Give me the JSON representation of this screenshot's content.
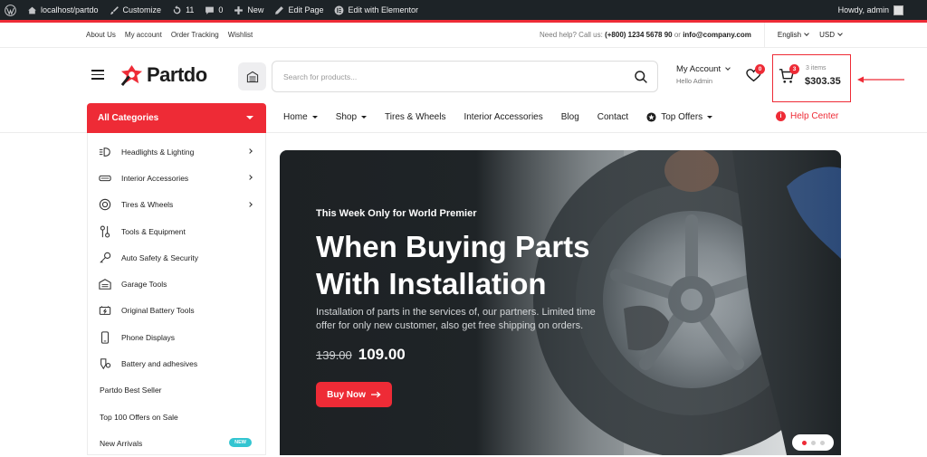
{
  "adminbar": {
    "site": "localhost/partdo",
    "customize": "Customize",
    "updates": "11",
    "comments": "0",
    "new": "New",
    "edit_page": "Edit Page",
    "elementor": "Edit with Elementor",
    "howdy": "Howdy, admin"
  },
  "topbar": {
    "links": [
      "About Us",
      "My account",
      "Order Tracking",
      "Wishlist"
    ],
    "help_prefix": "Need help? Call us:",
    "phone": "(+800) 1234 5678 90",
    "or": "or",
    "email": "info@company.com",
    "language": "English",
    "currency": "USD"
  },
  "header": {
    "logo": "Partdo",
    "search_placeholder": "Search for products...",
    "account_title": "My Account",
    "account_sub": "Hello Admin",
    "wishlist_count": "0",
    "cart_count": "3",
    "cart_items": "3 items",
    "cart_total": "$303.35"
  },
  "nav": {
    "all_categories": "All Categories",
    "items": [
      "Home",
      "Shop",
      "Tires & Wheels",
      "Interior Accessories",
      "Blog",
      "Contact",
      "Top Offers"
    ],
    "help_center": "Help Center"
  },
  "sidebar": {
    "categories": [
      {
        "label": "Headlights & Lighting",
        "icon": "headlight-icon"
      },
      {
        "label": "Interior Accessories",
        "icon": "seat-icon"
      },
      {
        "label": "Tires & Wheels",
        "icon": "tire-icon"
      },
      {
        "label": "Tools & Equipment",
        "icon": "wrench-icon"
      },
      {
        "label": "Auto Safety & Security",
        "icon": "key-icon"
      },
      {
        "label": "Garage Tools",
        "icon": "garage-icon"
      },
      {
        "label": "Original Battery Tools",
        "icon": "battery-icon"
      },
      {
        "label": "Phone Displays",
        "icon": "phone-icon"
      },
      {
        "label": "Battery and adhesives",
        "icon": "adhesive-icon"
      }
    ],
    "plain": [
      "Partdo Best Seller",
      "Top 100 Offers on Sale",
      "New Arrivals"
    ],
    "new_badge": "NEW"
  },
  "hero": {
    "pretitle": "This Week Only for World Premier",
    "title": "When Buying Parts With Installation",
    "description": "Installation of parts in the services of, our partners. Limited time offer for only new customer, also get free shipping on orders.",
    "old_price": "139.00",
    "new_price": "109.00",
    "button": "Buy Now"
  },
  "colors": {
    "accent": "#ee2b36",
    "adminbar": "#1d2327",
    "badge_new": "#33c5d1"
  }
}
